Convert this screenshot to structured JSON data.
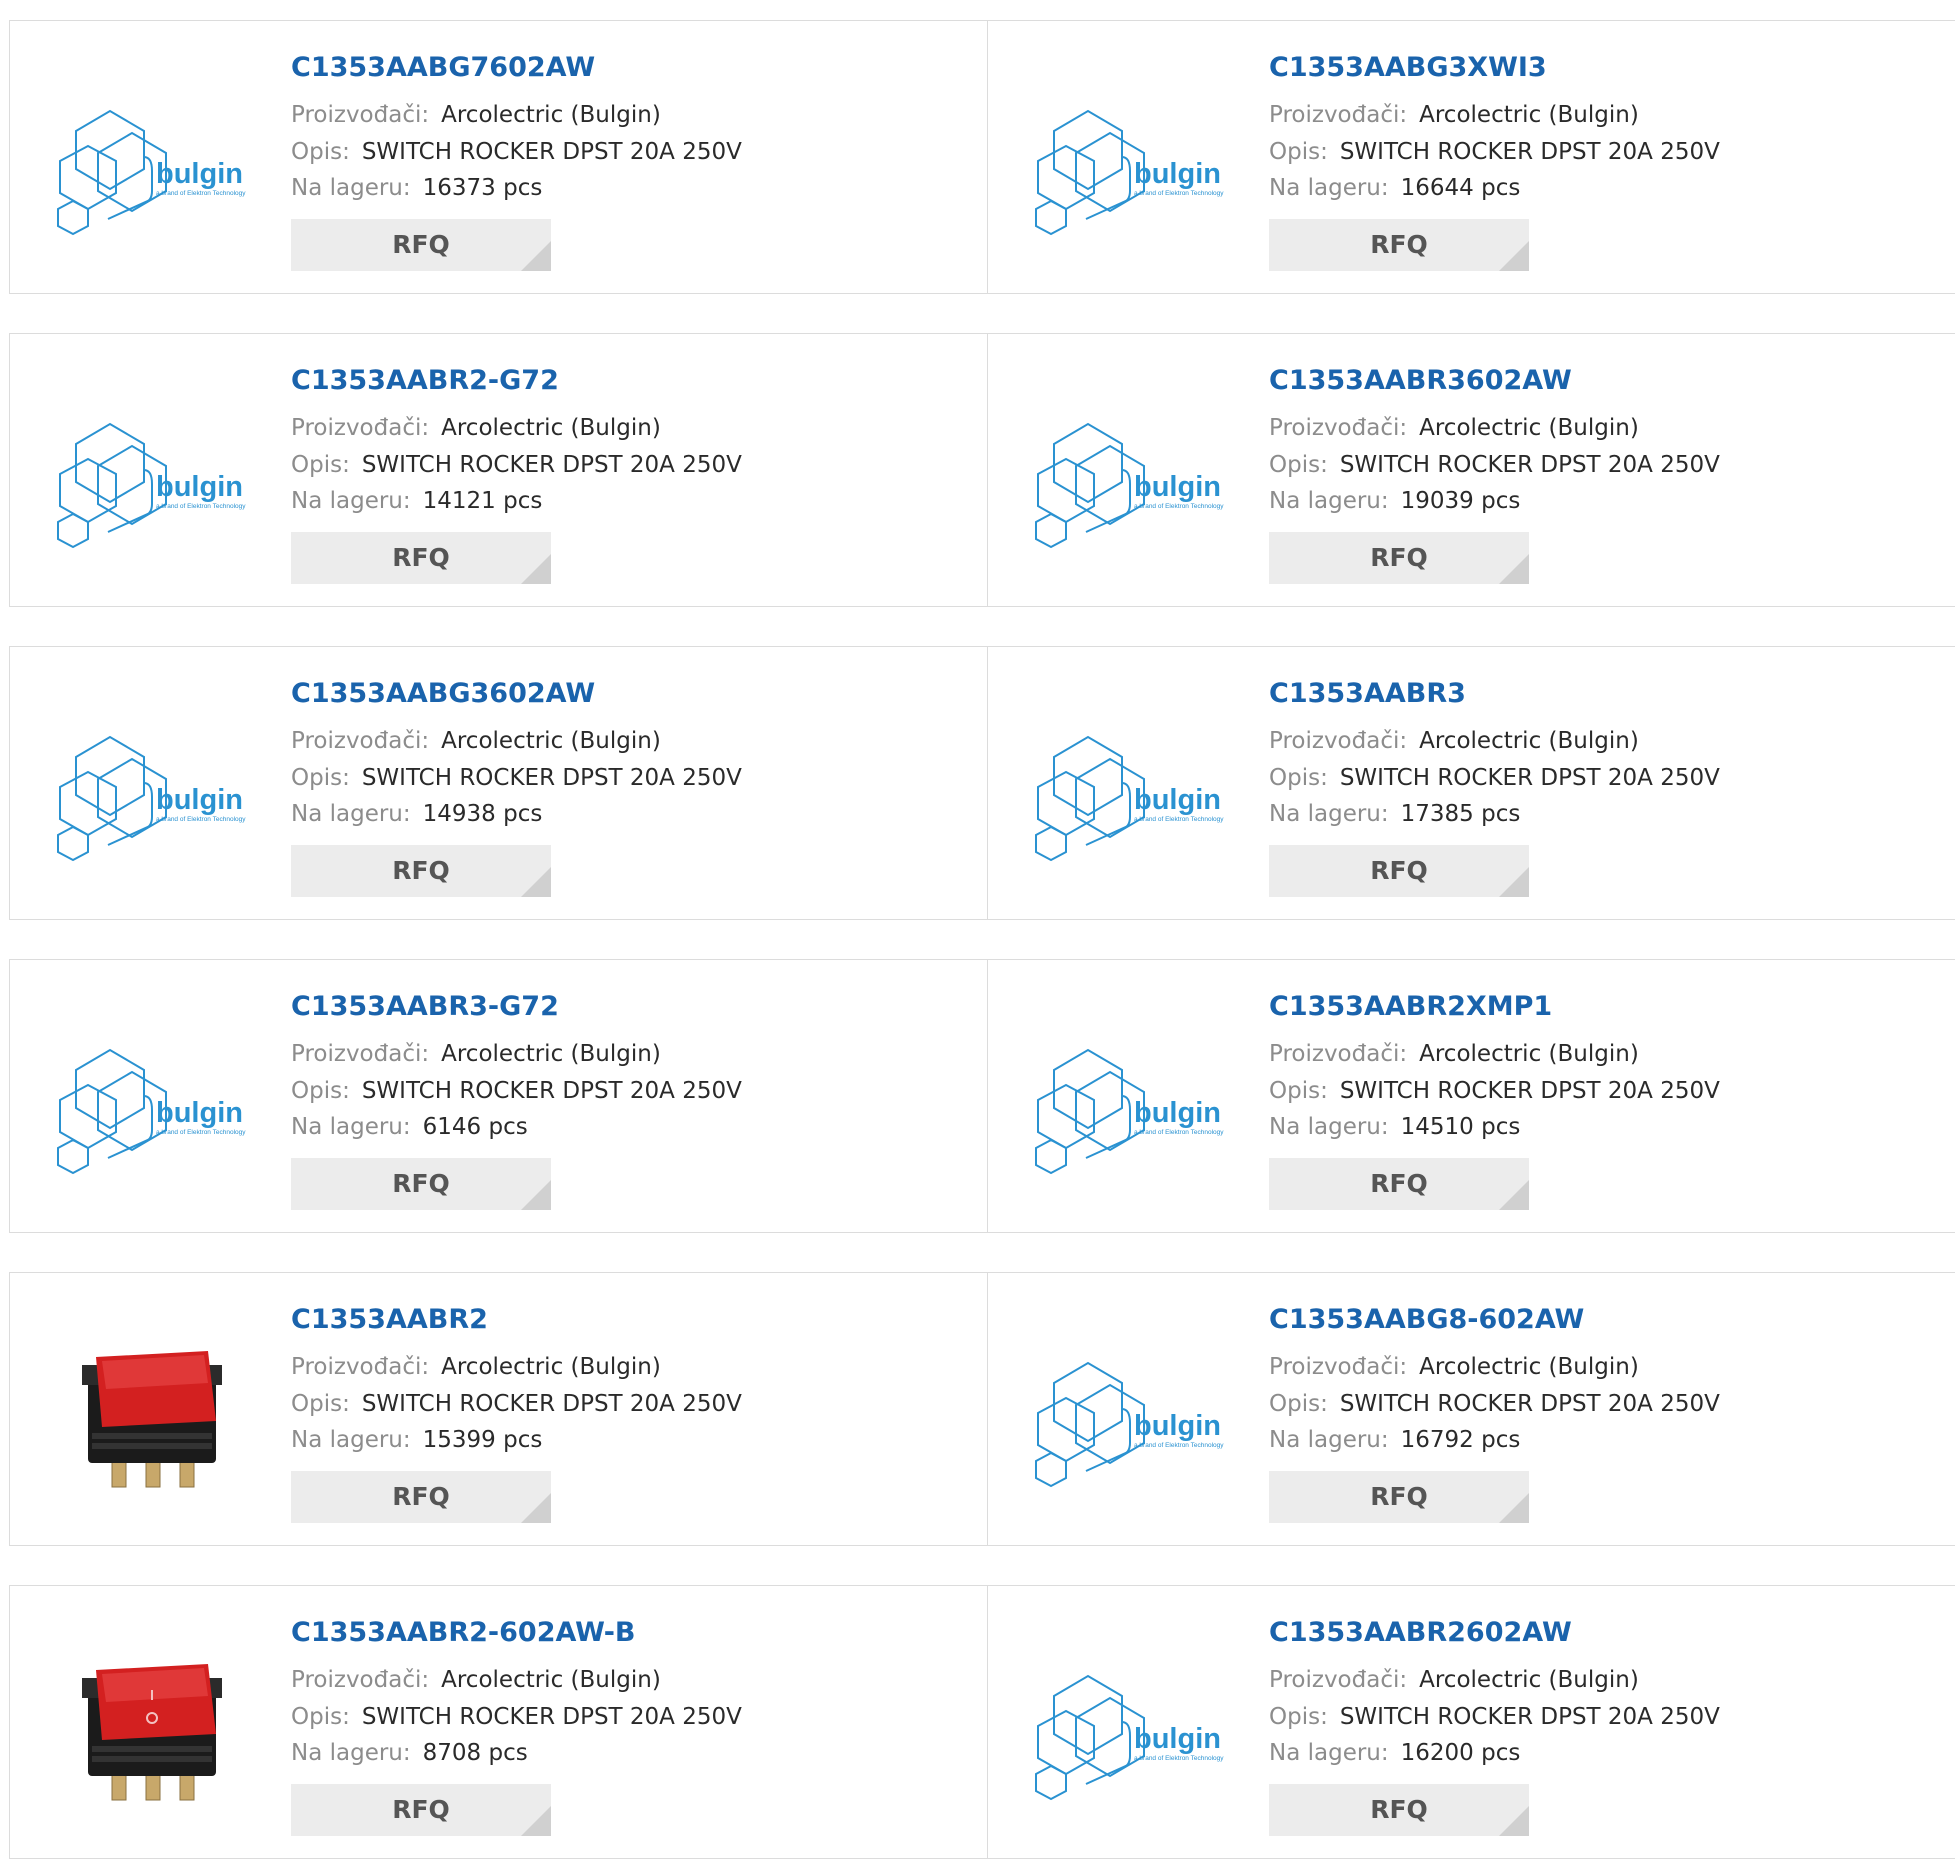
{
  "labels": {
    "manufacturer": "Proizvođači:",
    "description": "Opis:",
    "stock": "Na lageru:",
    "rfq": "RFQ"
  },
  "logo": {
    "brand": "bulgin",
    "tagline": "a brand of Elektron Technology"
  },
  "colors": {
    "link": "#1a63ac",
    "logo": "#2a92d1",
    "border": "#dcdcdc",
    "button": "#ececec"
  },
  "rows": [
    {
      "cards": [
        {
          "part": "C1353AABG7602AW",
          "manufacturer": "Arcolectric (Bulgin)",
          "description": "SWITCH ROCKER DPST 20A 250V",
          "stock": "16373 pcs",
          "image": "bulgin-logo"
        },
        {
          "part": "C1353AABG3XWI3",
          "manufacturer": "Arcolectric (Bulgin)",
          "description": "SWITCH ROCKER DPST 20A 250V",
          "stock": "16644 pcs",
          "image": "bulgin-logo"
        }
      ]
    },
    {
      "cards": [
        {
          "part": "C1353AABR2-G72",
          "manufacturer": "Arcolectric (Bulgin)",
          "description": "SWITCH ROCKER DPST 20A 250V",
          "stock": "14121 pcs",
          "image": "bulgin-logo"
        },
        {
          "part": "C1353AABR3602AW",
          "manufacturer": "Arcolectric (Bulgin)",
          "description": "SWITCH ROCKER DPST 20A 250V",
          "stock": "19039 pcs",
          "image": "bulgin-logo"
        }
      ]
    },
    {
      "cards": [
        {
          "part": "C1353AABG3602AW",
          "manufacturer": "Arcolectric (Bulgin)",
          "description": "SWITCH ROCKER DPST 20A 250V",
          "stock": "14938 pcs",
          "image": "bulgin-logo"
        },
        {
          "part": "C1353AABR3",
          "manufacturer": "Arcolectric (Bulgin)",
          "description": "SWITCH ROCKER DPST 20A 250V",
          "stock": "17385 pcs",
          "image": "bulgin-logo"
        }
      ]
    },
    {
      "cards": [
        {
          "part": "C1353AABR3-G72",
          "manufacturer": "Arcolectric (Bulgin)",
          "description": "SWITCH ROCKER DPST 20A 250V",
          "stock": "6146 pcs",
          "image": "bulgin-logo"
        },
        {
          "part": "C1353AABR2XMP1",
          "manufacturer": "Arcolectric (Bulgin)",
          "description": "SWITCH ROCKER DPST 20A 250V",
          "stock": "14510 pcs",
          "image": "bulgin-logo"
        }
      ]
    },
    {
      "cards": [
        {
          "part": "C1353AABR2",
          "manufacturer": "Arcolectric (Bulgin)",
          "description": "SWITCH ROCKER DPST 20A 250V",
          "stock": "15399 pcs",
          "image": "red-rocker-switch"
        },
        {
          "part": "C1353AABG8-602AW",
          "manufacturer": "Arcolectric (Bulgin)",
          "description": "SWITCH ROCKER DPST 20A 250V",
          "stock": "16792 pcs",
          "image": "bulgin-logo"
        }
      ]
    },
    {
      "cards": [
        {
          "part": "C1353AABR2-602AW-B",
          "manufacturer": "Arcolectric (Bulgin)",
          "description": "SWITCH ROCKER DPST 20A 250V",
          "stock": "8708 pcs",
          "image": "red-rocker-switch-io"
        },
        {
          "part": "C1353AABR2602AW",
          "manufacturer": "Arcolectric (Bulgin)",
          "description": "SWITCH ROCKER DPST 20A 250V",
          "stock": "16200 pcs",
          "image": "bulgin-logo"
        }
      ]
    }
  ]
}
